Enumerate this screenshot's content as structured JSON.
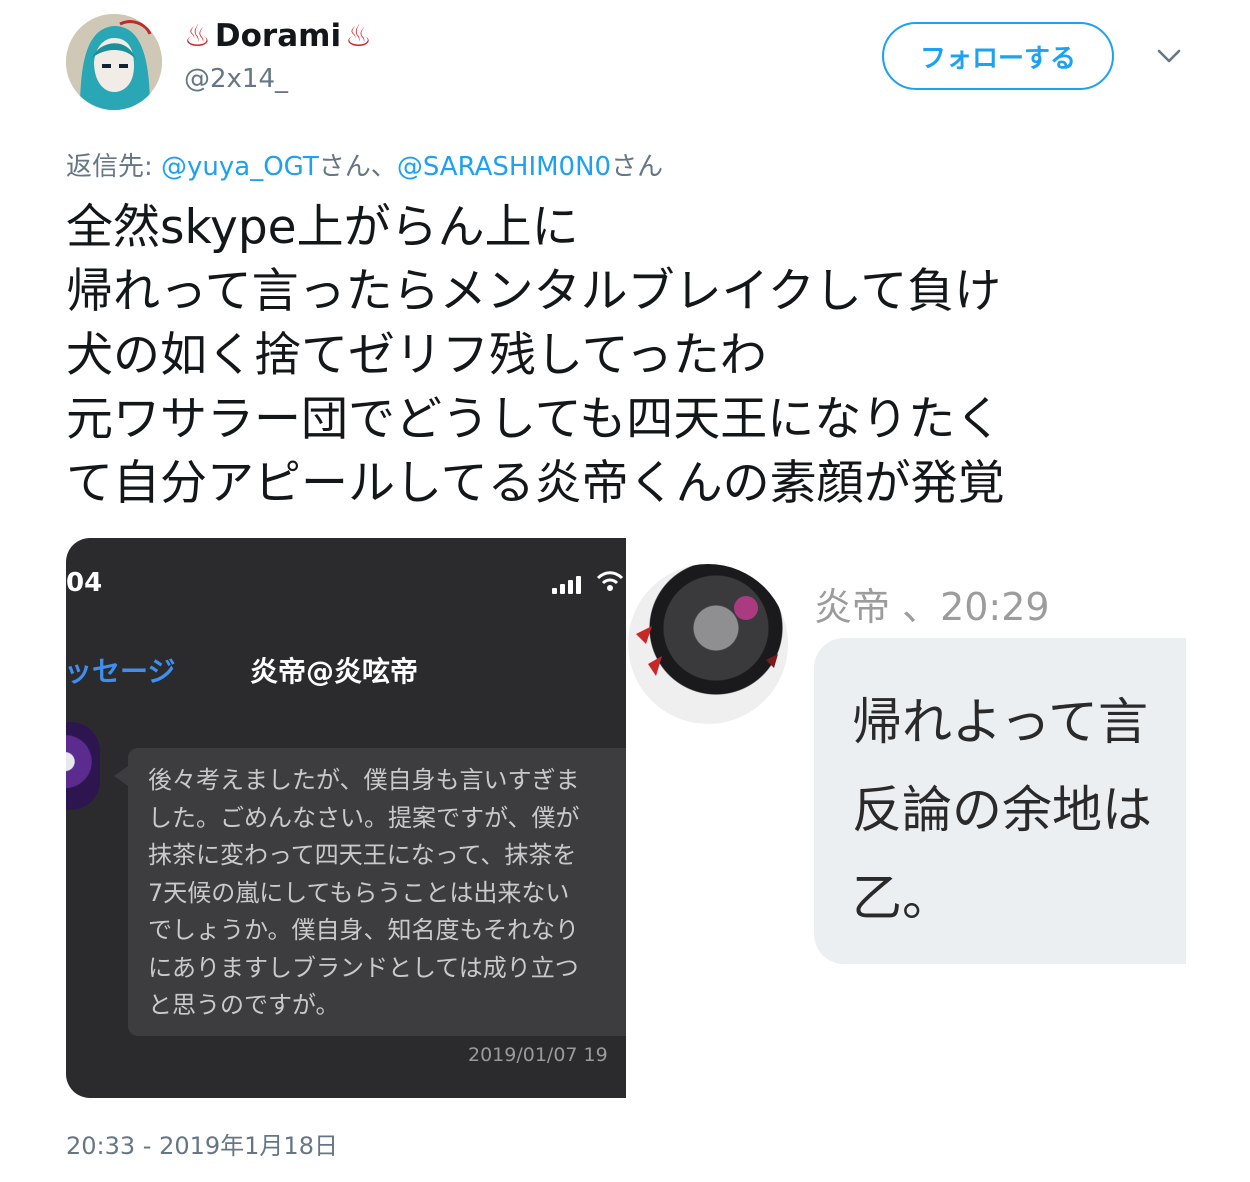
{
  "header": {
    "display_name": "Dorami",
    "name_emoji_left": "♨",
    "name_emoji_right": "♨",
    "handle": "@2x14_",
    "follow_label": "フォローする",
    "menu_icon": "chevron-down-icon"
  },
  "reply": {
    "prefix": "返信先: ",
    "mention1": "@yuya_OGT",
    "suffix1": "さん、",
    "mention2": "@SARASHIM0N0",
    "suffix2": "さん"
  },
  "tweet": {
    "text": "全然skype上がらん上に\n帰れって言ったらメンタルブレイクして負け\n犬の如く捨てゼリフ残してったわ\n元ワサラー団でどうしても四天王になりたく\nて自分アピールしてる炎帝くんの素顔が発覚"
  },
  "media": {
    "left": {
      "status_time": "04",
      "back_label": "ッセージ",
      "chat_title": "炎帝@炎呟帝",
      "message": "後々考えましたが、僕自身も言いすぎま\nした。ごめんなさい。提案ですが、僕が\n抹茶に変わって四天王になって、抹茶を\n7天候の嵐にしてもらうことは出来ない\nでしょうか。僕自身、知名度もそれなり\nにありますしブランドとしては成り立つ\nと思うのですが。",
      "date": "2019/01/07 19"
    },
    "right": {
      "sender_line": "炎帝 、20:29",
      "message": "帰れよって言\n反論の余地は\n乙。"
    }
  },
  "footer": {
    "timestamp": "20:33 - 2019年1月18日"
  },
  "colors": {
    "accent": "#1da1f2",
    "secondary_text": "#657786",
    "emoji_red": "#d5212b"
  }
}
